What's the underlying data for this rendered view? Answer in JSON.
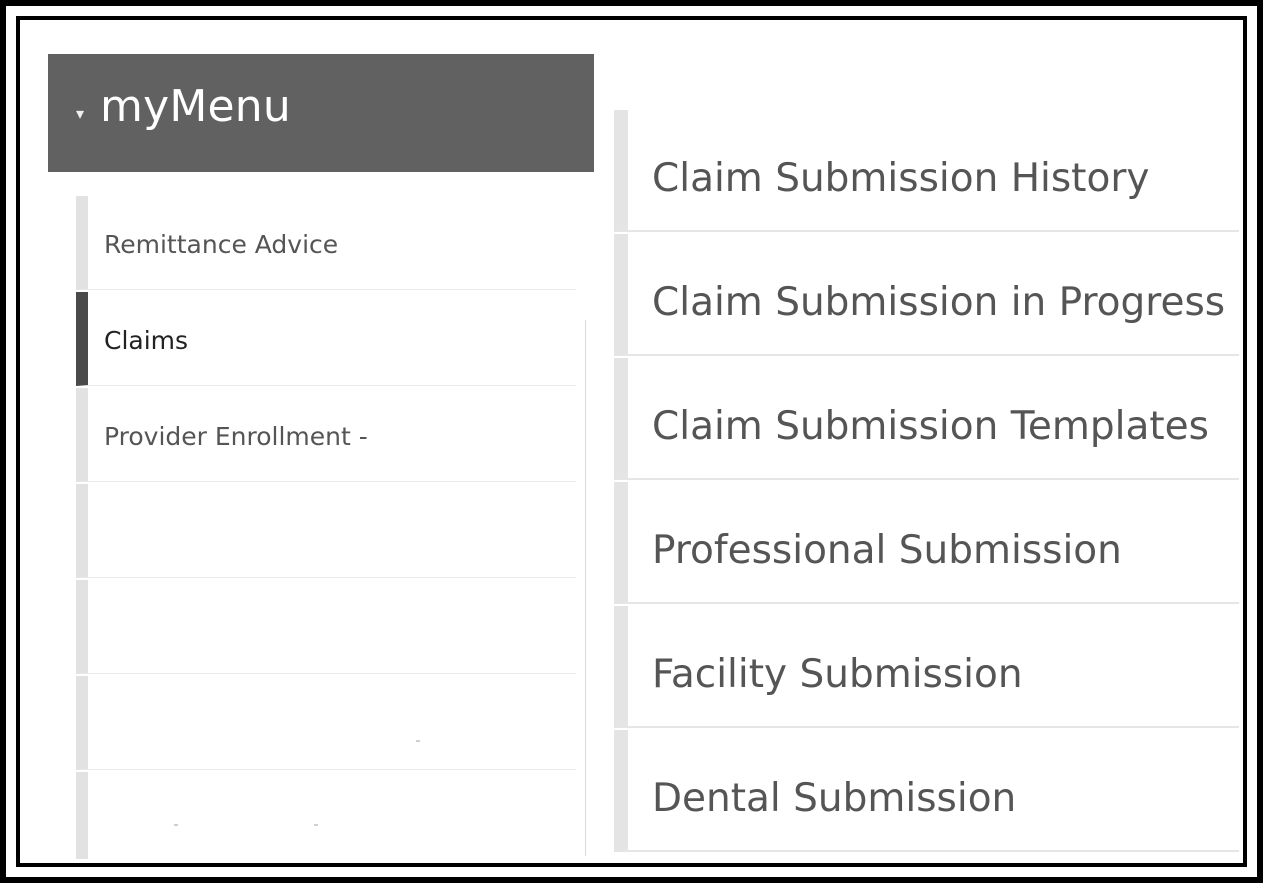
{
  "menu": {
    "title": "myMenu",
    "caret_icon": "▾",
    "items": [
      {
        "label": "Remittance Advice",
        "active": false
      },
      {
        "label": "Claims",
        "active": true
      },
      {
        "label": "Provider Enrollment -",
        "active": false
      }
    ]
  },
  "submenu": {
    "items": [
      {
        "label": "Claim Submission History"
      },
      {
        "label": "Claim Submission in Progress"
      },
      {
        "label": "Claim Submission Templates"
      },
      {
        "label": "Professional Submission"
      },
      {
        "label": "Facility Submission"
      },
      {
        "label": "Dental Submission"
      }
    ]
  }
}
